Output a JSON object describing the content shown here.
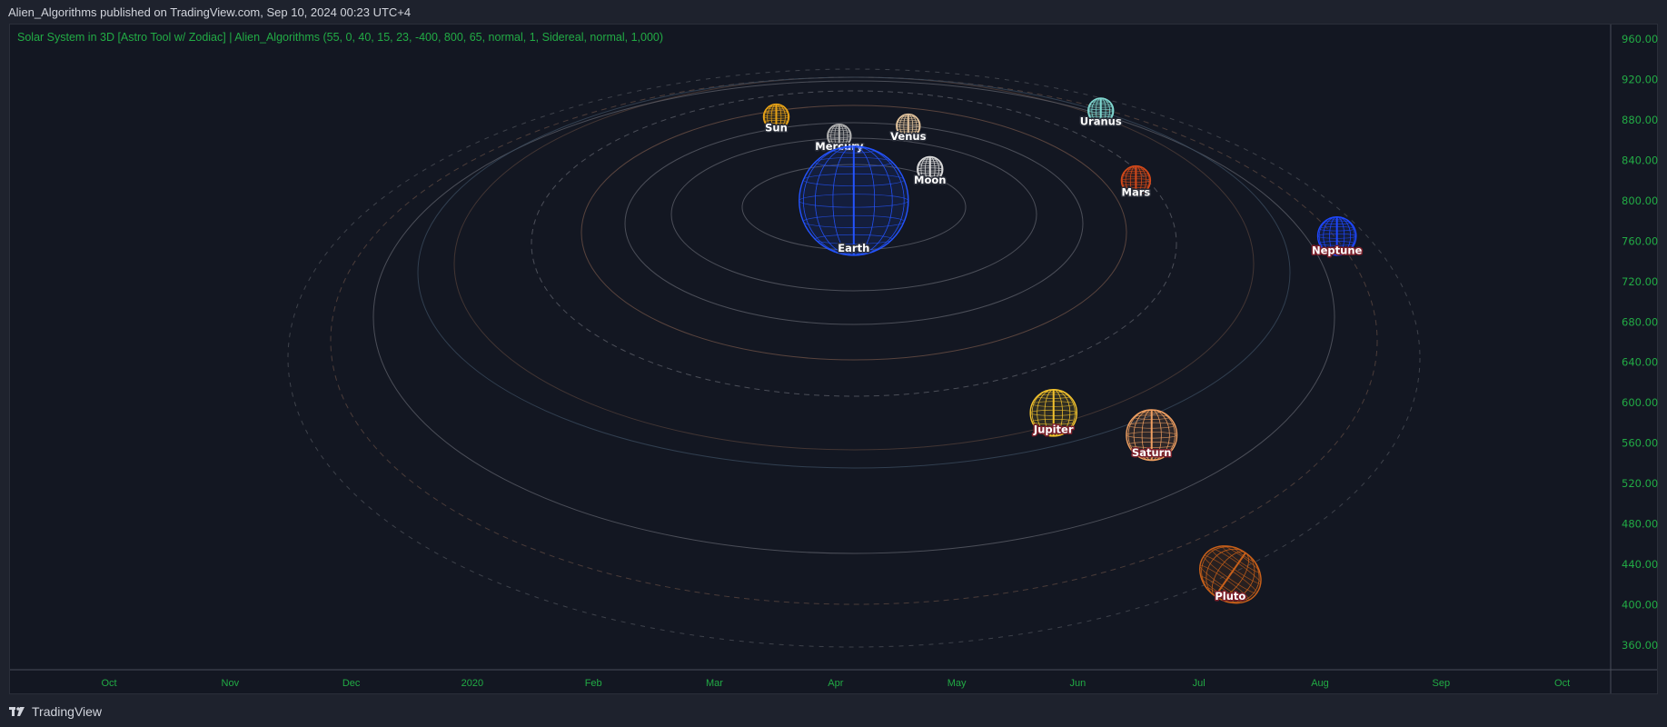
{
  "header": {
    "published": "Alien_Algorithms published on TradingView.com, Sep 10, 2024 00:23 UTC+4"
  },
  "indicator": {
    "title": "Solar System in 3D [Astro Tool w/ Zodiac] | Alien_Algorithms (55, 0, 40, 15, 23, -400, 800, 65, normal, 1, Sidereal, normal, 1,000)"
  },
  "footer": {
    "brand": "TradingView",
    "logo_icon": "tradingview-logo-icon"
  },
  "colors": {
    "background": "#131722",
    "frame": "#1e222d",
    "axis_text": "#22ab45"
  },
  "chart_data": {
    "type": "scatter",
    "title": "Solar System in 3D [Astro Tool w/ Zodiac]",
    "xlabel": "",
    "ylabel": "",
    "ylim": [
      340,
      975
    ],
    "y_ticks": [
      "960.00",
      "920.00",
      "880.00",
      "840.00",
      "800.00",
      "760.00",
      "720.00",
      "680.00",
      "640.00",
      "600.00",
      "560.00",
      "520.00",
      "480.00",
      "440.00",
      "400.00",
      "360.00"
    ],
    "x_ticks": [
      "Oct",
      "Nov",
      "Dec",
      "2020",
      "Feb",
      "Mar",
      "Apr",
      "May",
      "Jun",
      "Jul",
      "Aug",
      "Sep",
      "Oct"
    ],
    "x_unit": "months since Oct 2019",
    "grid": false,
    "points": [
      {
        "name": "Sun",
        "x": 5.51,
        "y": 883,
        "radius": 12.6,
        "color": "#e8a317",
        "label_glow": "#2a2e39"
      },
      {
        "name": "Mercury",
        "x": 6.03,
        "y": 864,
        "radius": 11.7,
        "color": "#b4b4b4",
        "label_glow": "#2a2e39"
      },
      {
        "name": "Venus",
        "x": 6.6,
        "y": 874,
        "radius": 11.7,
        "color": "#e2c39c",
        "label_glow": "#2a2e39"
      },
      {
        "name": "Moon",
        "x": 6.78,
        "y": 831,
        "radius": 12.6,
        "color": "#dcdcdc",
        "label_glow": "#2a2e39"
      },
      {
        "name": "Earth",
        "x": 6.15,
        "y": 800,
        "radius": 54,
        "color": "#2454ff",
        "label_glow": "#2a2e39"
      },
      {
        "name": "Uranus",
        "x": 8.19,
        "y": 889,
        "radius": 12.6,
        "color": "#80d8d0",
        "label_glow": "#2a2e39"
      },
      {
        "name": "Mars",
        "x": 8.48,
        "y": 820,
        "radius": 14.4,
        "color": "#d4491a",
        "label_glow": "#2a2e39"
      },
      {
        "name": "Neptune",
        "x": 10.14,
        "y": 765,
        "radius": 19,
        "color": "#1f48ff",
        "label_glow": "#7a1f2a"
      },
      {
        "name": "Jupiter",
        "x": 7.8,
        "y": 590,
        "radius": 23,
        "color": "#f2c22e",
        "label_glow": "#7a1f2a"
      },
      {
        "name": "Saturn",
        "x": 8.61,
        "y": 568,
        "radius": 25,
        "color": "#f0a062",
        "label_glow": "#7a1f2a"
      },
      {
        "name": "Pluto",
        "x": 9.26,
        "y": 430,
        "radius": 32,
        "color": "#c8601a",
        "label_glow": "#7a1f2a"
      }
    ]
  }
}
